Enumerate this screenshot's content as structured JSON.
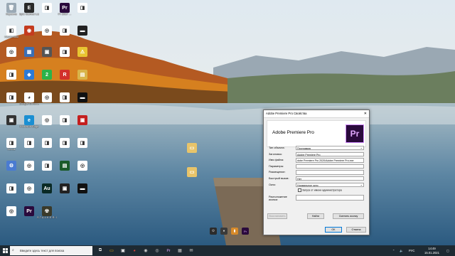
{
  "desktop_icons": [
    {
      "id": "recycle",
      "label": "Корзина",
      "color": "#9aa9b5",
      "glyph": "🗑"
    },
    {
      "id": "epic",
      "label": "Epic Games Launcher",
      "color": "#2a2a2a",
      "glyph": "E"
    },
    {
      "id": "file1",
      "label": "",
      "color": "#ffffff",
      "glyph": "◨"
    },
    {
      "id": "pr2017",
      "label": "Pr 2017 ...",
      "color": "#2a0a3c",
      "glyph": "Pr"
    },
    {
      "id": "file2",
      "label": "",
      "color": "#ffffff",
      "glyph": "◨"
    },
    {
      "id": "nastroi",
      "label": "Настройки",
      "color": "#ffffff",
      "glyph": "◧"
    },
    {
      "id": "r2a",
      "label": "",
      "color": "#c43b1e",
      "glyph": "◉"
    },
    {
      "id": "r2b",
      "label": "",
      "color": "#ffffff",
      "glyph": "◎"
    },
    {
      "id": "r2c",
      "label": "",
      "color": "#ffffff",
      "glyph": "◨"
    },
    {
      "id": "r2d",
      "label": "",
      "color": "#222222",
      "glyph": "▬"
    },
    {
      "id": "r2e",
      "label": "",
      "color": "#ffffff",
      "glyph": "◎"
    },
    {
      "id": "r3a",
      "label": "",
      "color": "#3a6fb5",
      "glyph": "▦"
    },
    {
      "id": "r3b",
      "label": "",
      "color": "#555555",
      "glyph": "▣"
    },
    {
      "id": "r3c",
      "label": "",
      "color": "#ffffff",
      "glyph": "◨"
    },
    {
      "id": "r3d",
      "label": "",
      "color": "#e8c431",
      "glyph": "⚠"
    },
    {
      "id": "r3e",
      "label": "",
      "color": "#ffffff",
      "glyph": "◨"
    },
    {
      "id": "r4a",
      "label": "",
      "color": "#2d7ad6",
      "glyph": "◆"
    },
    {
      "id": "r4b",
      "label": "",
      "color": "#2bb34a",
      "glyph": "2"
    },
    {
      "id": "r4c",
      "label": "",
      "color": "#d2302a",
      "glyph": "R"
    },
    {
      "id": "r4d",
      "label": "",
      "color": "#d9b44a",
      "glyph": "▤"
    },
    {
      "id": "r4e",
      "label": "",
      "color": "#ffffff",
      "glyph": "◨"
    },
    {
      "id": "chrome",
      "label": "Google Chrome",
      "color": "#ffffff",
      "glyph": "◕"
    },
    {
      "id": "r5b",
      "label": "",
      "color": "#ffffff",
      "glyph": "◎"
    },
    {
      "id": "r5c",
      "label": "",
      "color": "#ffffff",
      "glyph": "◨"
    },
    {
      "id": "r5d",
      "label": "",
      "color": "#111111",
      "glyph": "▬"
    },
    {
      "id": "r5e",
      "label": "",
      "color": "#333333",
      "glyph": "▣"
    },
    {
      "id": "edge",
      "label": "Microsoft Edge",
      "color": "#1b8fd2",
      "glyph": "e"
    },
    {
      "id": "r6b",
      "label": "",
      "color": "#ffffff",
      "glyph": "◎"
    },
    {
      "id": "r6c",
      "label": "",
      "color": "#ffffff",
      "glyph": "◨"
    },
    {
      "id": "r6d",
      "label": "",
      "color": "#c41f1f",
      "glyph": "▣"
    },
    {
      "id": "r6e",
      "label": "Nexus",
      "color": "#ffffff",
      "glyph": "◨"
    },
    {
      "id": "r7a",
      "label": "",
      "color": "#ffffff",
      "glyph": "◨"
    },
    {
      "id": "r7b",
      "label": "",
      "color": "#ffffff",
      "glyph": "◨"
    },
    {
      "id": "r7c",
      "label": "",
      "color": "#ffffff",
      "glyph": "◨"
    },
    {
      "id": "r7d",
      "label": "",
      "color": "#ffffff",
      "glyph": "◨"
    },
    {
      "id": "r8a",
      "label": "",
      "color": "#4a7bd1",
      "glyph": "⚙"
    },
    {
      "id": "r8b",
      "label": "",
      "color": "#ffffff",
      "glyph": "◎"
    },
    {
      "id": "r8c",
      "label": "",
      "color": "#ffffff",
      "glyph": "◨"
    },
    {
      "id": "r8d",
      "label": "",
      "color": "#1a5a2a",
      "glyph": "▤"
    },
    {
      "id": "r9a",
      "label": "",
      "color": "#ffffff",
      "glyph": "◎"
    },
    {
      "id": "r9b",
      "label": "",
      "color": "#ffffff",
      "glyph": "◨"
    },
    {
      "id": "r9c",
      "label": "",
      "color": "#ffffff",
      "glyph": "◎"
    },
    {
      "id": "au",
      "label": "",
      "color": "#0a2a25",
      "glyph": "Au"
    },
    {
      "id": "r10a",
      "label": "",
      "color": "#222222",
      "glyph": "▣"
    },
    {
      "id": "r10b",
      "label": "",
      "color": "#111111",
      "glyph": "▬"
    },
    {
      "id": "r10c",
      "label": "",
      "color": "#ffffff",
      "glyph": "◎"
    },
    {
      "id": "pr2",
      "label": "",
      "color": "#2a0a3c",
      "glyph": "Pr"
    },
    {
      "id": "stalker",
      "label": "S.T.A.L.K.E.R. Clear Sky",
      "color": "#3a3a2a",
      "glyph": "☢"
    },
    {
      "id": "folder1",
      "label": "",
      "color": "#e8c46a",
      "glyph": "▭"
    },
    {
      "id": "folder2",
      "label": "",
      "color": "#e8c46a",
      "glyph": "▭"
    }
  ],
  "dialog": {
    "title": "Adobe Premiere Pro Свойства",
    "app_name": "Adobe Premiere Pro",
    "icon_text": "Pr",
    "rows": [
      {
        "key": "Тип объекта:",
        "value": "Программа",
        "type": "select"
      },
      {
        "key": "Заголовок:",
        "value": "Adobe Premiere Pro",
        "type": "text"
      },
      {
        "key": "Имя файла:",
        "value": "dobe Premiere Pro 2020\\Adobe Premiere Pro.exe",
        "type": "text"
      },
      {
        "key": "Параметры:",
        "value": "",
        "type": "text"
      },
      {
        "key": "Размещение:",
        "value": "",
        "type": "text"
      },
      {
        "key": "Быстрый вызов:",
        "value": "Нет",
        "type": "text"
      },
      {
        "key": "Окно:",
        "value": "Нормальное окно",
        "type": "select"
      }
    ],
    "checkbox_label": "Запуск от имени администратора",
    "location_key": "Расположение иконки:",
    "buttons": {
      "default": "Восстановить",
      "find": "Найти",
      "change_icon": "Сменить иконку",
      "ok": "OK",
      "cancel": "Отмена"
    }
  },
  "taskbar": {
    "search_placeholder": "Введите здесь текст для поиска",
    "language": "РУС",
    "time": "14:49",
    "date": "15.01.2021"
  },
  "colors": {
    "taskbar_bg": "#1e2a33",
    "premiere_border": "#d08bff",
    "premiere_bg": "#2a0a3c"
  }
}
